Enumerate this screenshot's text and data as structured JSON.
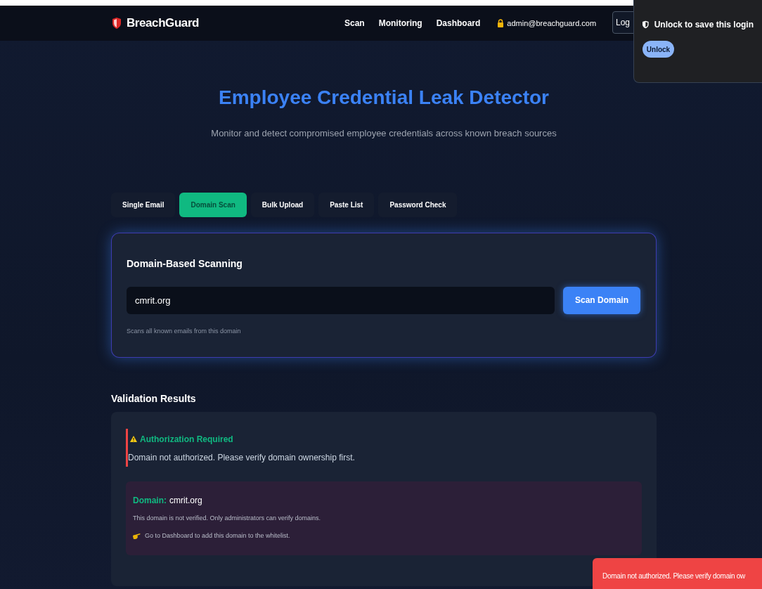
{
  "navbar": {
    "brand": "BreachGuard",
    "links": [
      {
        "label": "Scan"
      },
      {
        "label": "Monitoring"
      },
      {
        "label": "Dashboard"
      }
    ],
    "user": "admin@breachguard.com",
    "logout": "Log"
  },
  "popup": {
    "title": "Unlock to save this login",
    "button": "Unlock"
  },
  "hero": {
    "title": "Employee Credential Leak Detector",
    "subtitle": "Monitor and detect compromised employee credentials across known breach sources"
  },
  "tabs": [
    {
      "label": "Single Email",
      "selected": false
    },
    {
      "label": "Domain Scan",
      "selected": true
    },
    {
      "label": "Bulk Upload",
      "selected": false
    },
    {
      "label": "Paste List",
      "selected": false
    },
    {
      "label": "Password Check",
      "selected": false
    }
  ],
  "scan_card": {
    "title": "Domain-Based Scanning",
    "value": "cmrit.org",
    "button": "Scan Domain",
    "hint": "Scans all known emails from this domain"
  },
  "results": {
    "heading": "Validation Results",
    "alert_title": "Authorization Required",
    "alert_message": "Domain not authorized. Please verify domain ownership first.",
    "domain_label": "Domain:",
    "domain_value": "cmrit.org",
    "info": "This domain is not verified. Only administrators can verify domains.",
    "tip": "Go to Dashboard to add this domain to the whitelist."
  },
  "toast": {
    "message": "Domain not authorized. Please verify domain ow"
  }
}
